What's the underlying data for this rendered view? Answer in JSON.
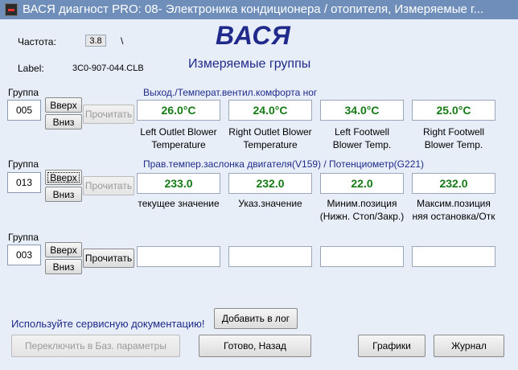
{
  "window": {
    "title": "ВАСЯ диагност PRO: 08- Электроника кондиционера / отопителя,  Измеряемые г..."
  },
  "header": {
    "freq_label": "Частота:",
    "freq_value": "3.8",
    "freq_indicator": "\\",
    "label_label": "Label:",
    "label_value": "3C0-907-044.CLB",
    "logo_text": "ВАСЯ",
    "subtitle": "Измеряемые группы"
  },
  "groups": [
    {
      "label": "Группа",
      "number": "005",
      "up_label": "Вверх",
      "down_label": "Вниз",
      "read_label": "Прочитать",
      "title": "Выход./Температ.вентил.комфорта ног",
      "values": [
        "26.0°C",
        "24.0°C",
        "34.0°C",
        "25.0°C"
      ],
      "descriptions": [
        "Left Outlet Blower\nTemperature",
        "Right Outlet Blower\nTemperature",
        "Left Footwell\nBlower Temp.",
        "Right Footwell\nBlower Temp."
      ]
    },
    {
      "label": "Группа",
      "number": "013",
      "up_label": "Вверх",
      "down_label": "Вниз",
      "read_label": "Прочитать",
      "title": "Прав.темпер.заслонка двигателя(V159) / Потенциометр(G221)",
      "values": [
        "233.0",
        "232.0",
        "22.0",
        "232.0"
      ],
      "descriptions": [
        "текущее значение",
        "Указ.значение",
        "Миним.позиция\n(Нижн. Стоп/Закр.)",
        "Максим.позиция\nняя остановка/Отк"
      ]
    },
    {
      "label": "Группа",
      "number": "003",
      "up_label": "Вверх",
      "down_label": "Вниз",
      "read_label": "Прочитать",
      "title": "",
      "values": [
        "",
        "",
        "",
        ""
      ],
      "descriptions": [
        "",
        "",
        "",
        ""
      ]
    }
  ],
  "footer": {
    "service_doc_text": "Используйте сервисную документацию!",
    "add_log_label": "Добавить в лог",
    "switch_basic_label": "Переключить в Баз. параметры",
    "done_back_label": "Готово, Назад",
    "graphs_label": "Графики",
    "journal_label": "Журнал"
  }
}
